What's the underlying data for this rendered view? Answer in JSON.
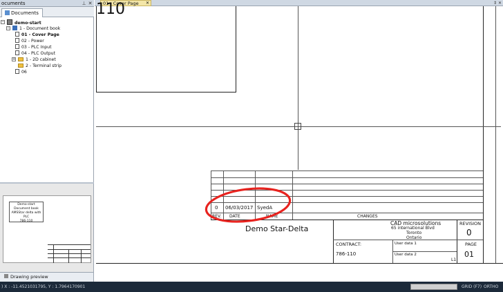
{
  "panel": {
    "title": "ocuments",
    "pin": "⊥",
    "close": "✕",
    "tab_label": "Documents"
  },
  "tree": {
    "project": "demo-start",
    "book": "1 - Document book",
    "items": [
      {
        "label": "01 - Cover Page",
        "kind": "doc",
        "bold": true
      },
      {
        "label": "02 - Power",
        "kind": "doc",
        "bold": false
      },
      {
        "label": "03 - PLC Input",
        "kind": "doc",
        "bold": false
      },
      {
        "label": "04 - PLC Output",
        "kind": "doc",
        "bold": false
      },
      {
        "label": "1 - 2D cabinet",
        "kind": "folder",
        "bold": false
      },
      {
        "label": "2 - Terminal strip",
        "kind": "folder",
        "bold": false
      },
      {
        "label": "06",
        "kind": "doc",
        "bold": false
      }
    ]
  },
  "preview": {
    "line1": "Demo-start",
    "line2": "Document book",
    "line3": "AMSStar delta with PLC",
    "line4": "786-110",
    "tab_label": "Drawing preview"
  },
  "doc_tab": {
    "label": "01 - Cover Page",
    "close": "✕",
    "tools": "⇕ ✕"
  },
  "drawing": {
    "big_number": "110",
    "rev_row": {
      "rev": "0",
      "date": "06/03/2017",
      "name": "SyedA"
    },
    "headers": {
      "rev": "REV.",
      "date": "DATE",
      "name": "NAME",
      "changes": "CHANGES"
    },
    "project_title": "Demo Star-Delta",
    "company": {
      "name": "CAD microsolutions",
      "street": "65 international Blvd",
      "city": "Toronto",
      "province": "Ontario"
    },
    "revision_label": "REVISION",
    "revision_value": "0",
    "contract_label": "CONTRACT:",
    "contract_value": "786-110",
    "user_data_1": "User data 1",
    "user_data_2": "User data 2",
    "page_label": "PAGE",
    "page_value": "01",
    "sheet_code": "L1",
    "annotation_color": "#e8231f"
  },
  "status": {
    "coords": ") X : -11.4521031795, Y : 1.7964170901",
    "grid": "GRID (F7)",
    "ortho": "ORTHO (F8)"
  }
}
